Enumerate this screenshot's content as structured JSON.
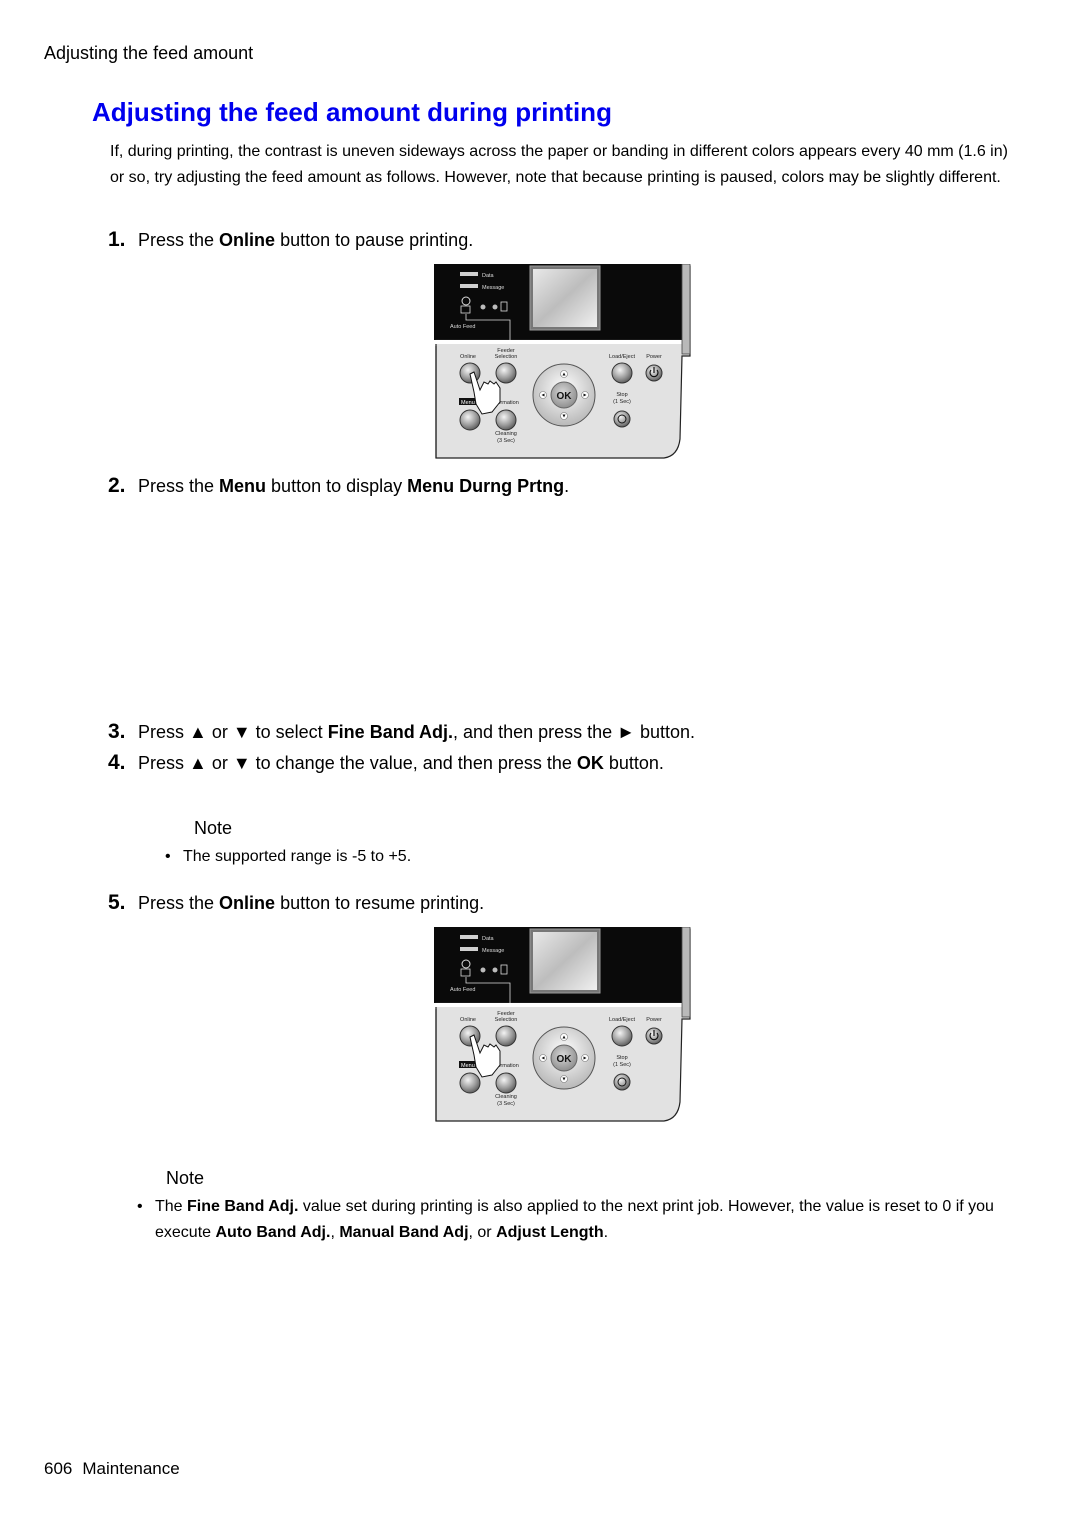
{
  "running_head": "Adjusting the feed amount",
  "title": "Adjusting the feed amount during printing",
  "intro": "If, during printing, the contrast is uneven sideways across the paper or banding in different colors appears every 40 mm (1.6 in) or so, try adjusting the feed amount as follows. However, note that because printing is paused, colors may be slightly different.",
  "steps": [
    {
      "num": "1.",
      "pre": "Press the ",
      "b1": "Online",
      "post": " button to pause printing."
    },
    {
      "num": "2.",
      "pre": "Press the ",
      "b1": "Menu",
      "mid": " button to display ",
      "b2": "Menu Durng Prtng",
      "post": "."
    },
    {
      "num": "3.",
      "pre": "Press ▲ or ▼ to select ",
      "b1": "Fine Band Adj.",
      "post": ", and then press the ► button."
    },
    {
      "num": "4.",
      "pre": "Press ▲ or ▼ to change the value, and then press the ",
      "b1": "OK",
      "post": " button."
    },
    {
      "num": "5.",
      "pre": "Press the ",
      "b1": "Online",
      "post": " button to resume printing."
    }
  ],
  "notes": [
    {
      "heading": "Note",
      "items": [
        {
          "text": "The supported range is -5 to +5."
        }
      ]
    },
    {
      "heading": "Note",
      "items": [
        {
          "t1": "The ",
          "b1": "Fine Band Adj.",
          "t2": " value set during printing is also applied to the next print job. However, the value is reset to 0 if you execute ",
          "b2": "Auto Band Adj.",
          "t3": ", ",
          "b3": "Manual Band Adj",
          "t4": ", or ",
          "b4": "Adjust Length",
          "t5": "."
        }
      ]
    }
  ],
  "panel": {
    "led_data": "Data",
    "led_message": "Message",
    "auto_feed": "Auto Feed",
    "online": "Online",
    "feeder_1": "Feeder",
    "feeder_2": "Selection",
    "menu": "Menu",
    "information": "Information",
    "cleaning_1": "Cleaning",
    "cleaning_2": "(3 Sec)",
    "ok": "OK",
    "load_eject": "Load/Eject",
    "power": "Power",
    "stop_1": "Stop",
    "stop_2": "(1 Sec)"
  },
  "footer": {
    "page": "606",
    "section": "Maintenance"
  }
}
